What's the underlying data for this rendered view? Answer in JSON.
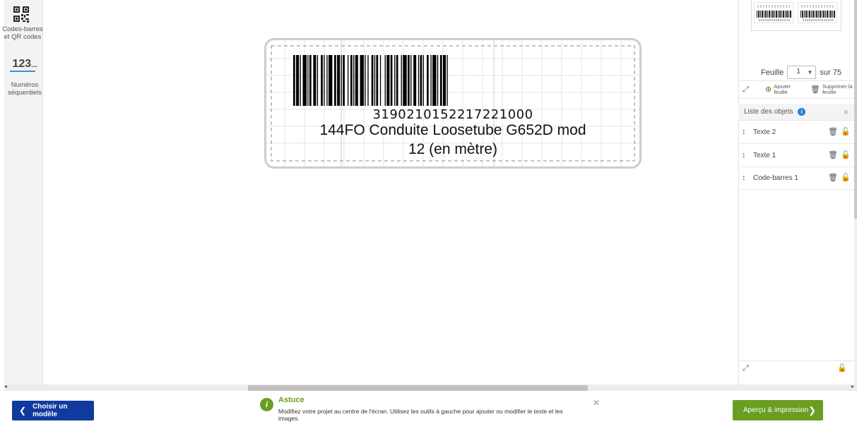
{
  "left_toolbar": {
    "barcodes_label_line1": "Codes-barres",
    "barcodes_label_line2": "et QR codes",
    "sequential_number": "123",
    "sequential_dots": "...",
    "sequential_label_line1": "Numéros",
    "sequential_label_line2": "séquentiels"
  },
  "label": {
    "barcode_number": "3190210152217221000",
    "text_line1": "144FO Conduite Loosetube G652D mod",
    "text_line2": "12 (en mètre)"
  },
  "sheet": {
    "label": "Feuille",
    "current": "1",
    "of_text": "sur 75",
    "add_line1": "Ajouter",
    "add_line2": "feuille",
    "delete_line1": "Supprimer la",
    "delete_line2": "feuille"
  },
  "objects_panel": {
    "title": "Liste des objets",
    "items": [
      {
        "name": "Texte 2"
      },
      {
        "name": "Texte 1"
      },
      {
        "name": "Code-barres 1"
      }
    ]
  },
  "bottom_bar": {
    "choose_model": "Choisir un modèle",
    "tip_title": "Astuce",
    "tip_body": "Modifiez votre projet au centre de l'écran. Utilisez les outils à gauche pour ajouter ou modifier le texte et les images.",
    "preview_print": "Aperçu & impression"
  },
  "colors": {
    "primary_blue": "#0f3a9e",
    "accent_green": "#6a9e23",
    "info_blue": "#2a7dd1"
  },
  "icons": [
    "qr-code-icon",
    "expand-icon",
    "add-sheet-icon",
    "trash-icon",
    "info-icon",
    "close-icon",
    "drag-handle-icon",
    "lock-icon",
    "chevron-left-icon",
    "chevron-right-icon",
    "dropdown-caret-icon"
  ]
}
